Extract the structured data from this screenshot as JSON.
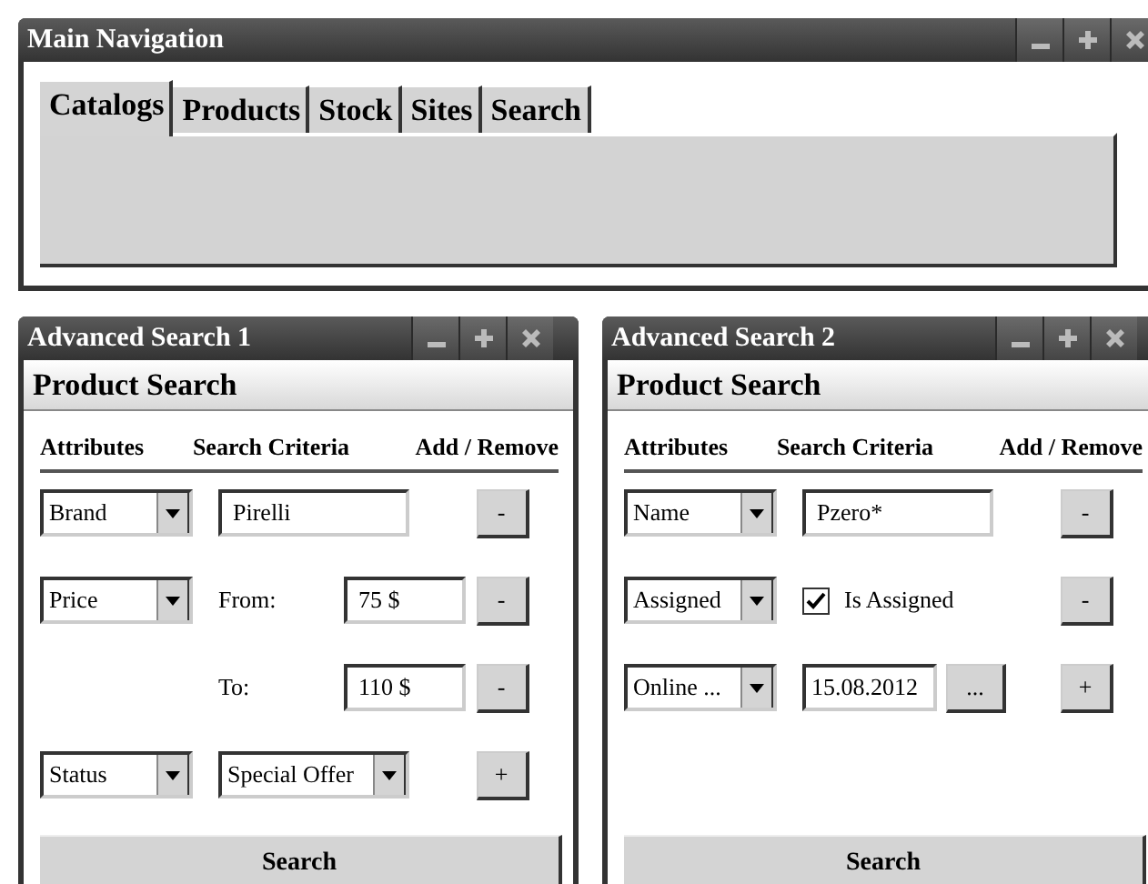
{
  "main_window": {
    "title": "Main Navigation",
    "tabs": [
      {
        "label": "Catalogs",
        "selected": true
      },
      {
        "label": "Products",
        "selected": false
      },
      {
        "label": "Stock",
        "selected": false
      },
      {
        "label": "Sites",
        "selected": false
      },
      {
        "label": "Search",
        "selected": false
      }
    ]
  },
  "search_windows": [
    {
      "title": "Advanced Search 1",
      "heading": "Product Search",
      "columns": [
        "Attributes",
        "Search Criteria",
        "Add / Remove"
      ],
      "rows": [
        {
          "attribute": "Brand",
          "criteria": {
            "kind": "text",
            "value": "Pirelli"
          },
          "action": "-"
        },
        {
          "attribute": "Price",
          "criteria": {
            "kind": "labeled_text",
            "label": "From:",
            "value": "75 $"
          },
          "action": "-"
        },
        {
          "criteria": {
            "kind": "labeled_text",
            "label": "To:",
            "value": "110 $"
          },
          "action": "-"
        },
        {
          "attribute": "Status",
          "criteria": {
            "kind": "select",
            "value": "Special Offer"
          },
          "action": "+"
        }
      ],
      "button": "Search"
    },
    {
      "title": "Advanced Search 2",
      "heading": "Product Search",
      "columns": [
        "Attributes",
        "Search Criteria",
        "Add / Remove"
      ],
      "rows": [
        {
          "attribute": "Name",
          "criteria": {
            "kind": "text",
            "value": "Pzero*"
          },
          "action": "-"
        },
        {
          "attribute": "Assigned",
          "criteria": {
            "kind": "checkbox",
            "label": "Is Assigned",
            "checked": true
          },
          "action": "-"
        },
        {
          "attribute": "Online ...",
          "criteria": {
            "kind": "date",
            "value": "15.08.2012",
            "button": "..."
          },
          "action": "+"
        }
      ],
      "button": "Search"
    }
  ]
}
